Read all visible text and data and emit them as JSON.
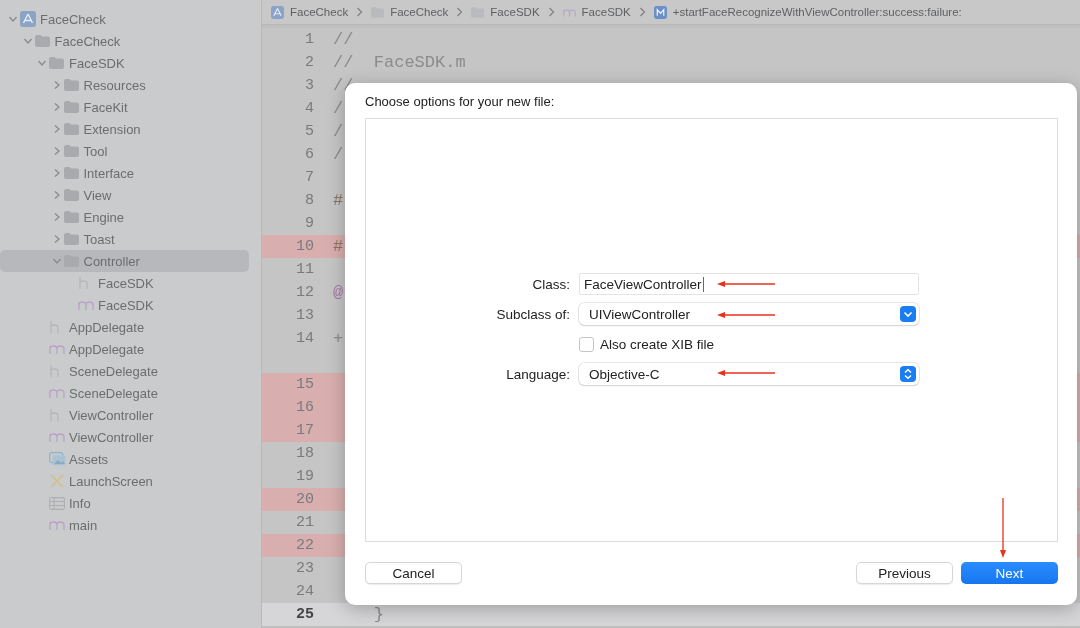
{
  "navigator": {
    "items": [
      {
        "label": "FaceCheck",
        "kind": "project",
        "expanded": true,
        "selected": false,
        "children": [
          {
            "label": "FaceCheck",
            "kind": "folder",
            "expanded": true,
            "selected": false,
            "children": [
              {
                "label": "FaceSDK",
                "kind": "folder",
                "expanded": true,
                "selected": false,
                "children": [
                  {
                    "label": "Resources",
                    "kind": "folder",
                    "expanded": false,
                    "selected": false
                  },
                  {
                    "label": "FaceKit",
                    "kind": "folder",
                    "expanded": false,
                    "selected": false
                  },
                  {
                    "label": "Extension",
                    "kind": "folder",
                    "expanded": false,
                    "selected": false
                  },
                  {
                    "label": "Tool",
                    "kind": "folder",
                    "expanded": false,
                    "selected": false
                  },
                  {
                    "label": "Interface",
                    "kind": "folder",
                    "expanded": false,
                    "selected": false
                  },
                  {
                    "label": "View",
                    "kind": "folder",
                    "expanded": false,
                    "selected": false
                  },
                  {
                    "label": "Engine",
                    "kind": "folder",
                    "expanded": false,
                    "selected": false
                  },
                  {
                    "label": "Toast",
                    "kind": "folder",
                    "expanded": false,
                    "selected": false
                  },
                  {
                    "label": "Controller",
                    "kind": "folder",
                    "expanded": true,
                    "selected": true,
                    "children": [
                      {
                        "label": "FaceSDK",
                        "kind": "header",
                        "selected": false
                      },
                      {
                        "label": "FaceSDK",
                        "kind": "source",
                        "selected": false
                      }
                    ]
                  }
                ]
              },
              {
                "label": "AppDelegate",
                "kind": "header",
                "selected": false
              },
              {
                "label": "AppDelegate",
                "kind": "source",
                "selected": false
              },
              {
                "label": "SceneDelegate",
                "kind": "header",
                "selected": false
              },
              {
                "label": "SceneDelegate",
                "kind": "source",
                "selected": false
              },
              {
                "label": "ViewController",
                "kind": "header",
                "selected": false
              },
              {
                "label": "ViewController",
                "kind": "source",
                "selected": false
              },
              {
                "label": "Assets",
                "kind": "assets",
                "selected": false
              },
              {
                "label": "LaunchScreen",
                "kind": "storyboard",
                "selected": false
              },
              {
                "label": "Info",
                "kind": "plist",
                "selected": false
              },
              {
                "label": "main",
                "kind": "source",
                "selected": false
              }
            ]
          }
        ]
      }
    ]
  },
  "breadcrumb": [
    {
      "label": "FaceCheck",
      "kind": "project"
    },
    {
      "label": "FaceCheck",
      "kind": "folder"
    },
    {
      "label": "FaceSDK",
      "kind": "folder"
    },
    {
      "label": "FaceSDK",
      "kind": "source"
    },
    {
      "label": "+startFaceRecognizeWithViewController:success:failure:",
      "kind": "method"
    }
  ],
  "editor": {
    "lines": [
      {
        "number": "1",
        "text": "//",
        "highlighted": false,
        "current": false,
        "wraps": false
      },
      {
        "number": "2",
        "text": "//  FaceSDK.m",
        "highlighted": false,
        "current": false,
        "wraps": false
      },
      {
        "number": "3",
        "text": "//",
        "highlighted": false,
        "current": false,
        "wraps": false
      },
      {
        "number": "4",
        "text": "/",
        "highlighted": false,
        "current": false,
        "wraps": false
      },
      {
        "number": "5",
        "text": "/",
        "highlighted": false,
        "current": false,
        "wraps": false
      },
      {
        "number": "6",
        "text": "/",
        "highlighted": false,
        "current": false,
        "wraps": false
      },
      {
        "number": "7",
        "highlighted": false,
        "current": false,
        "wraps": false
      },
      {
        "number": "8",
        "text": "#",
        "highlighted": false,
        "current": false,
        "wraps": false,
        "kind": "directive"
      },
      {
        "number": "9",
        "highlighted": false,
        "current": false,
        "wraps": false
      },
      {
        "number": "10",
        "text": "#",
        "highlighted": true,
        "current": false,
        "wraps": false,
        "kind": "directive"
      },
      {
        "number": "11",
        "highlighted": false,
        "current": false,
        "wraps": false
      },
      {
        "number": "12",
        "text": "@",
        "highlighted": false,
        "current": false,
        "wraps": false,
        "kind": "keyword"
      },
      {
        "number": "13",
        "highlighted": false,
        "current": false,
        "wraps": false
      },
      {
        "number": "14",
        "text": "+",
        "highlighted": false,
        "current": false,
        "wraps": true
      },
      {
        "number": "15",
        "highlighted": true,
        "current": false,
        "wraps": false
      },
      {
        "number": "16",
        "highlighted": true,
        "current": false,
        "wraps": false
      },
      {
        "number": "17",
        "highlighted": true,
        "current": false,
        "wraps": false
      },
      {
        "number": "18",
        "highlighted": false,
        "current": false,
        "wraps": false
      },
      {
        "number": "19",
        "highlighted": false,
        "current": false,
        "wraps": false
      },
      {
        "number": "20",
        "highlighted": true,
        "current": false,
        "wraps": false
      },
      {
        "number": "21",
        "highlighted": false,
        "current": false,
        "wraps": false
      },
      {
        "number": "22",
        "highlighted": true,
        "current": false,
        "wraps": false
      },
      {
        "number": "23",
        "highlighted": false,
        "current": false,
        "wraps": false
      },
      {
        "number": "24",
        "highlighted": false,
        "current": false,
        "wraps": false
      },
      {
        "number": "25",
        "text": "    }",
        "highlighted": false,
        "current": true,
        "wraps": false
      }
    ]
  },
  "dialog": {
    "title": "Choose options for your new file:",
    "fields": [
      {
        "kind": "text",
        "label": "Class:",
        "value": "FaceViewController",
        "focused": true
      },
      {
        "kind": "popup",
        "label": "Subclass of:",
        "value": "UIViewController"
      },
      {
        "kind": "checkbox",
        "label": "Also create XIB file",
        "checked": false
      },
      {
        "kind": "stepper-popup",
        "label": "Language:",
        "value": "Objective-C"
      }
    ],
    "buttons": [
      {
        "label": "Cancel",
        "kind": "secondary"
      },
      {
        "label": "Previous",
        "kind": "secondary"
      },
      {
        "label": "Next",
        "kind": "default"
      }
    ]
  }
}
